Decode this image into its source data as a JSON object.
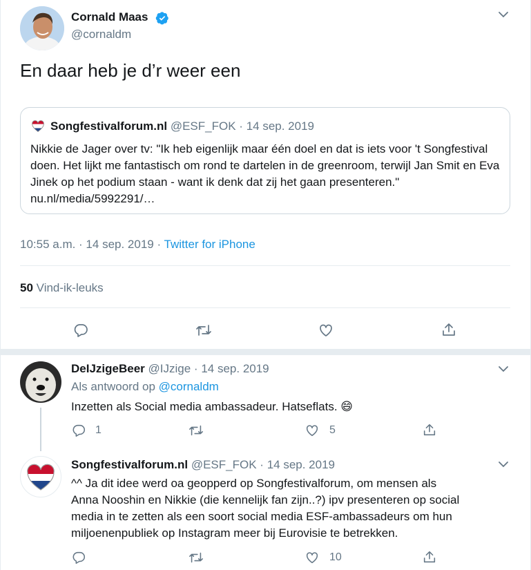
{
  "main_tweet": {
    "author_name": "Cornald Maas",
    "author_handle": "@cornaldm",
    "text": "En daar heb je d’r weer een",
    "quoted": {
      "name": "Songfestivalforum.nl",
      "handle": "@ESF_FOK",
      "sep": "·",
      "date": "14 sep. 2019",
      "text": "Nikkie de Jager over tv: \"Ik heb eigenlijk maar één doel en dat is iets voor 't Songfestival doen. Het lijkt me fantastisch om rond te dartelen in de greenroom, terwijl Jan Smit en Eva Jinek op het podium staan - want ik denk dat zij het gaan presenteren.\" nu.nl/media/5992291/…"
    },
    "meta_time": "10:55 a.m. · 14 sep. 2019 ·",
    "meta_source": "Twitter for iPhone",
    "likes_count": "50",
    "likes_label": "Vind-ik-leuks"
  },
  "reply1": {
    "name": "DeIJzigeBeer",
    "handle": "@IJzige",
    "sep": "·",
    "date": "14 sep. 2019",
    "reply_prefix": "Als antwoord op",
    "reply_to": "@cornaldm",
    "text": "Inzetten als Social media ambassadeur. Hatseflats.",
    "emoji": "😄",
    "reply_count": "1",
    "retweet_count": "",
    "like_count": "5"
  },
  "reply2": {
    "name": "Songfestivalforum.nl",
    "handle": "@ESF_FOK",
    "sep": "·",
    "date": "14 sep. 2019",
    "lines": [
      "^^ Ja dit idee werd oa geopperd op Songfestivalforum, om mensen als",
      "Anna Nooshin en Nikkie (die kennelijk fan zijn..?) ipv presenteren op social",
      "media in te zetten als een soort social media ESF-ambassadeurs om hun",
      "miljoenenpubliek op Instagram meer bij Eurovisie te betrekken."
    ],
    "reply_count": "",
    "retweet_count": "",
    "like_count": "10"
  },
  "colors": {
    "accent": "#1b95e0",
    "muted": "#657786",
    "border": "#e6ecf0"
  }
}
